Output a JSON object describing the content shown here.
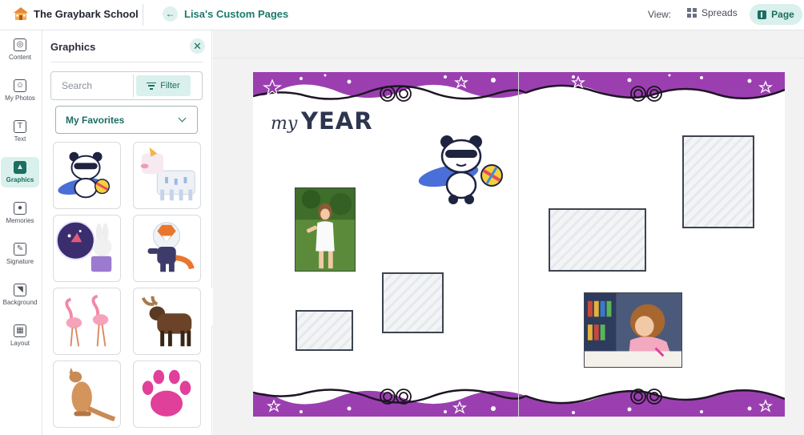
{
  "header": {
    "school_name": "The Graybark School",
    "back_label": "Lisa's Custom Pages",
    "view_label": "View:",
    "spreads_label": "Spreads",
    "page_label": "Page"
  },
  "rail": {
    "items": [
      {
        "label": "Content",
        "icon": "content-icon"
      },
      {
        "label": "My Photos",
        "icon": "photos-icon"
      },
      {
        "label": "Text",
        "icon": "text-icon"
      },
      {
        "label": "Graphics",
        "icon": "graphics-icon",
        "active": true
      },
      {
        "label": "Memories",
        "icon": "memories-icon"
      },
      {
        "label": "Signature",
        "icon": "signature-icon"
      },
      {
        "label": "Background",
        "icon": "background-icon"
      },
      {
        "label": "Layout",
        "icon": "layout-icon"
      }
    ]
  },
  "panel": {
    "title": "Graphics",
    "search_placeholder": "Search",
    "filter_label": "Filter",
    "category": "My Favorites",
    "graphics": [
      "panda-surfer",
      "dog",
      "astronaut-bunny",
      "astronaut-fox",
      "flamingos",
      "moose",
      "kangaroo",
      "paw-print"
    ]
  },
  "page": {
    "title_small": "my",
    "title_big": "YEAR"
  },
  "colors": {
    "accent": "#1b6e62",
    "accent_light": "#d9f0ec",
    "border_purple": "#9b3fb0"
  }
}
